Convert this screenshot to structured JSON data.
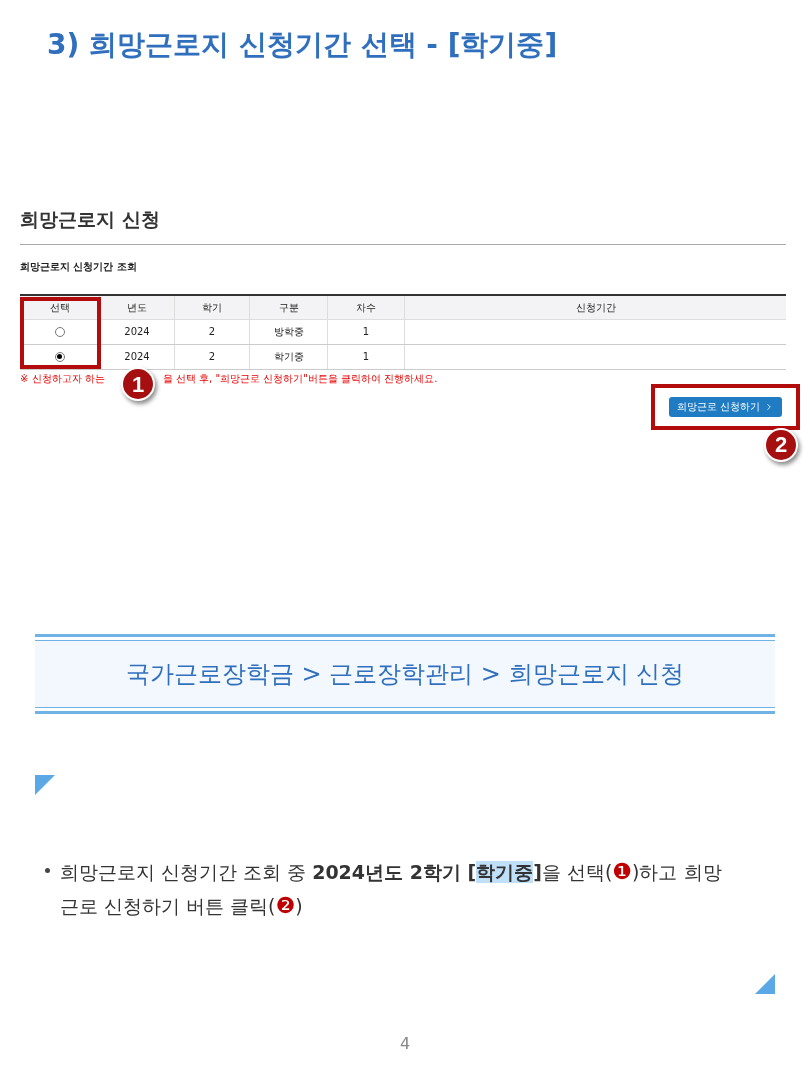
{
  "title": "3) 희망근로지 신청기간 선택 - [학기중]",
  "screenshot": {
    "heading": "희망근로지 신청",
    "subheading": "희망근로지 신청기간 조회",
    "table": {
      "columns": [
        "선택",
        "년도",
        "학기",
        "구분",
        "차수",
        "신청기간"
      ],
      "rows": [
        {
          "selected": false,
          "cells": [
            "",
            "2024",
            "2",
            "방학중",
            "1"
          ]
        },
        {
          "selected": true,
          "cells": [
            "",
            "2024",
            "2",
            "학기중",
            "1"
          ]
        }
      ]
    },
    "notice": [
      "※ 신청하고자 하는",
      "을 선택 후, \"희망근로 신청하기\"버튼을 클릭하여 진행하세요."
    ],
    "button": "희망근로 신청하기",
    "callouts": [
      "1",
      "2"
    ]
  },
  "breadcrumb": "국가근로장학금 > 근로장학관리 > 희망근로지 신청",
  "bullet": [
    {
      "kind": "text",
      "text": "희망근로지 신청기간 조회 중 ",
      "bold": false,
      "highlight": false
    },
    {
      "kind": "text",
      "text": "2024년도 2학기 [",
      "bold": true,
      "highlight": false
    },
    {
      "kind": "text",
      "text": "학기중",
      "bold": true,
      "highlight": true
    },
    {
      "kind": "text",
      "text": "]",
      "bold": true,
      "highlight": false
    },
    {
      "kind": "text",
      "text": "을 선택(",
      "bold": false,
      "highlight": false
    },
    {
      "kind": "marker",
      "text": "❶",
      "bold": false,
      "highlight": false
    },
    {
      "kind": "text",
      "text": ")하고 희망근로 신청하기 버튼 클릭(",
      "bold": false,
      "highlight": false
    },
    {
      "kind": "marker",
      "text": "❷",
      "bold": false,
      "highlight": false
    },
    {
      "kind": "text",
      "text": ")",
      "bold": false,
      "highlight": false
    }
  ],
  "page_number": "4"
}
